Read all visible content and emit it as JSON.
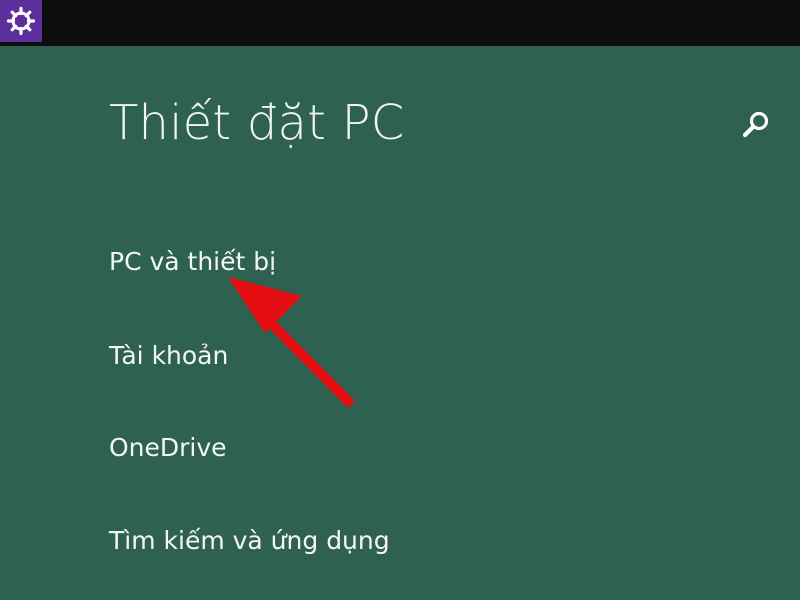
{
  "window": {
    "title": "Thiết đặt PC"
  },
  "topbar": {
    "settings_icon": "gear-icon"
  },
  "header": {
    "search_icon": "search-icon"
  },
  "nav": {
    "items": [
      {
        "label": "PC và thiết bị"
      },
      {
        "label": "Tài khoản"
      },
      {
        "label": "OneDrive"
      },
      {
        "label": "Tìm kiếm và ứng dụng"
      }
    ]
  },
  "annotation": {
    "arrow_color": "#e30d12"
  },
  "colors": {
    "background": "#2f6150",
    "topbar": "#0d0d0d",
    "settings_tile": "#5b2f9c",
    "text": "#f2f5f3"
  }
}
